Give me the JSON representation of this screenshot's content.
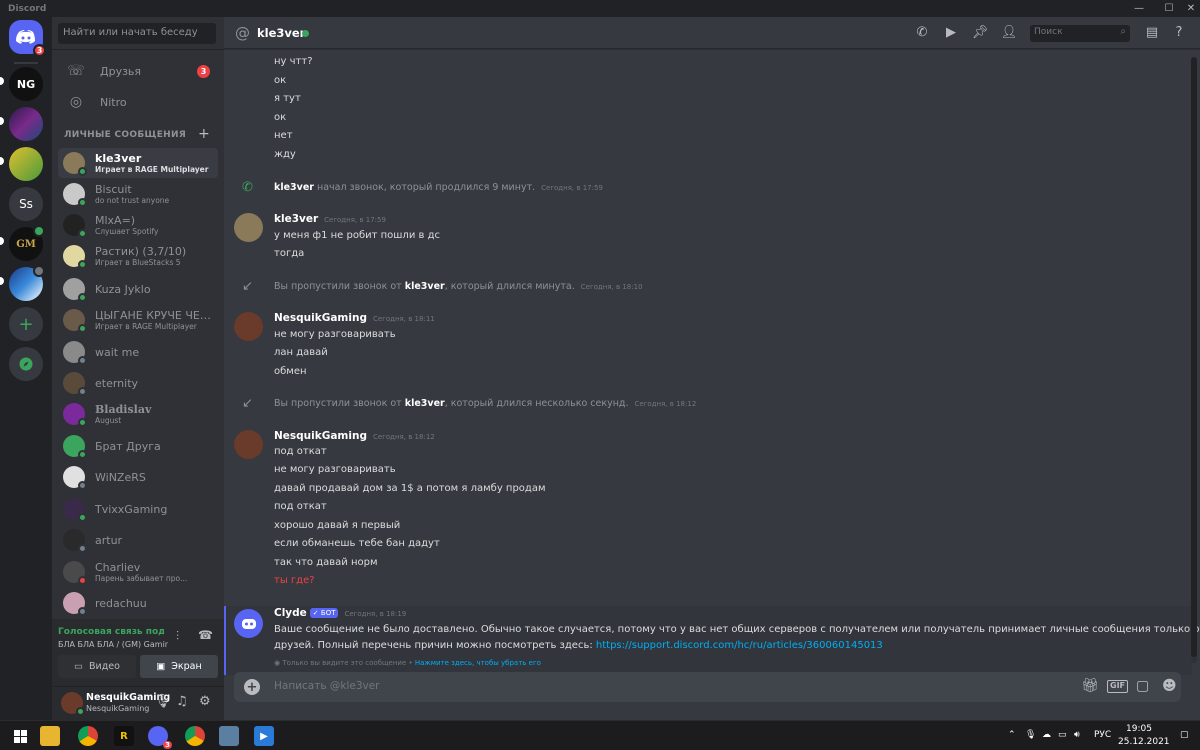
{
  "titlebar": {
    "title": "Discord",
    "minimize": "—",
    "maximize": "☐",
    "close": "✕"
  },
  "servers": {
    "home_badge": "3",
    "items": [
      "NG",
      "",
      "",
      "Ss",
      "GM",
      ""
    ],
    "add": "+",
    "explore": "⊙"
  },
  "sidebar": {
    "search_placeholder": "Найти или начать беседу",
    "friends": "Друзья",
    "friends_badge": "3",
    "nitro": "Nitro",
    "dm_header": "ЛИЧНЫЕ СООБЩЕНИЯ",
    "dm_add": "+",
    "dms": [
      {
        "name": "kle3ver",
        "sub": "Играет в RAGE Multiplayer"
      },
      {
        "name": "Biscuit",
        "sub": "do not trust anyone"
      },
      {
        "name": "MlxA=)",
        "sub": "Слушает Spotify"
      },
      {
        "name": "Растик) (3,7/10)",
        "sub": "Играет в BlueStacks 5"
      },
      {
        "name": "Kuza Jyklo",
        "sub": ""
      },
      {
        "name": "ЦЫГАНЕ КРУЧЕ ЧЕРНЫХ",
        "sub": "Играет в RAGE Multiplayer"
      },
      {
        "name": "wait me",
        "sub": ""
      },
      {
        "name": "eternity",
        "sub": ""
      },
      {
        "name": "Bladislav",
        "sub": "August"
      },
      {
        "name": "Брат Друга",
        "sub": ""
      },
      {
        "name": "WiNZeRS",
        "sub": ""
      },
      {
        "name": "TvixxGaming",
        "sub": ""
      },
      {
        "name": "artur",
        "sub": ""
      },
      {
        "name": "Charliev",
        "sub": "Парень забывает про..."
      },
      {
        "name": "redachuu",
        "sub": ""
      }
    ]
  },
  "voice": {
    "status": "Голосовая связь подключена",
    "detail": "БЛА БЛА БЛА / (GM) Gaming",
    "video": "Видео",
    "screen": "Экран"
  },
  "user": {
    "name": "NesquikGaming",
    "tag": "NesquikGaming"
  },
  "header": {
    "at": "@",
    "name": "kle3ver",
    "search": "Поиск"
  },
  "messages": {
    "top_lines": [
      "ну чтт?",
      "ок",
      "я тут",
      "ок",
      "нет",
      "жду"
    ],
    "call1": {
      "name": "kle3ver",
      "text": "начал звонок, который продлился 9 минут.",
      "ts": "Сегодня, в 17:59"
    },
    "msg1": {
      "author": "kle3ver",
      "ts": "Сегодня, в 17:59",
      "lines": [
        "у меня ф1 не робит пошли в дс",
        "тогда"
      ]
    },
    "missed1": {
      "pre": "Вы пропустили звонок от",
      "name": "kle3ver",
      "post": ", который длился минута.",
      "ts": "Сегодня, в 18:10"
    },
    "msg2": {
      "author": "NesquikGaming",
      "ts": "Сегодня, в 18:11",
      "lines": [
        "не могу разговаривать",
        "лан давай",
        "обмен"
      ]
    },
    "missed2": {
      "pre": "Вы пропустили звонок от",
      "name": "kle3ver",
      "post": ", который длился несколько секунд.",
      "ts": "Сегодня, в 18:12"
    },
    "msg3": {
      "author": "NesquikGaming",
      "ts": "Сегодня, в 18:12",
      "lines": [
        "под откат",
        "не могу разговаривать",
        "давай продавай дом за 1$ а потом я ламбу продам",
        "под откат",
        "хорошо давай я первый",
        "если обманешь тебе бан дадут",
        "так что давай норм"
      ],
      "failed": "ты где?"
    },
    "clyde": {
      "author": "Clyde",
      "bot": "✓ БОТ",
      "ts": "Сегодня, в 18:19",
      "text1": "Ваше сообщение не было доставлено. Обычно такое случается, потому что у вас нет общих серверов с получателем или получатель принимает личные сообщения только от",
      "text2": "друзей. Полный перечень причин можно посмотреть здесь:",
      "link": "https://support.discord.com/hc/ru/articles/360060145013",
      "note": "Только вы видите это сообщение •",
      "dismiss": "Нажмите здесь, чтобы убрать его"
    }
  },
  "composer": {
    "placeholder": "Написать @kle3ver",
    "gif": "GIF"
  },
  "taskbar": {
    "lang": "РУС",
    "time": "19:05",
    "date": "25.12.2021",
    "chrome_badge": "3"
  },
  "colors": {
    "accent": "#5865f2",
    "online": "#3ba55d",
    "danger": "#ed4245",
    "link": "#00aff4"
  }
}
